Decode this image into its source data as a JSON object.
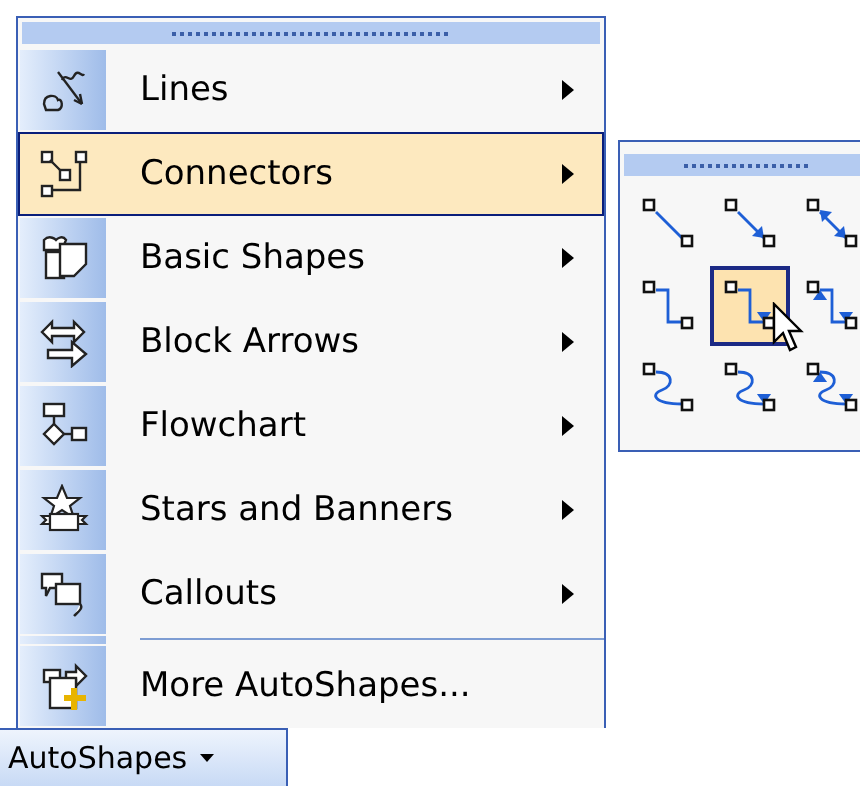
{
  "menu": {
    "items": [
      {
        "label": "Lines",
        "submenu": true,
        "selected": false,
        "separator_before": false
      },
      {
        "label": "Connectors",
        "submenu": true,
        "selected": true,
        "separator_before": false
      },
      {
        "label": "Basic Shapes",
        "submenu": true,
        "selected": false,
        "separator_before": false
      },
      {
        "label": "Block Arrows",
        "submenu": true,
        "selected": false,
        "separator_before": false
      },
      {
        "label": "Flowchart",
        "submenu": true,
        "selected": false,
        "separator_before": false
      },
      {
        "label": "Stars and Banners",
        "submenu": true,
        "selected": false,
        "separator_before": false
      },
      {
        "label": "Callouts",
        "submenu": true,
        "selected": false,
        "separator_before": false
      },
      {
        "label": "More AutoShapes...",
        "submenu": false,
        "selected": false,
        "separator_before": true
      }
    ]
  },
  "connector_palette": {
    "cells": [
      {
        "selected": false
      },
      {
        "selected": false
      },
      {
        "selected": false
      },
      {
        "selected": false
      },
      {
        "selected": true
      },
      {
        "selected": false
      },
      {
        "selected": false
      },
      {
        "selected": false
      },
      {
        "selected": false
      }
    ]
  },
  "toolbar_button": {
    "label": "AutoShapes"
  }
}
